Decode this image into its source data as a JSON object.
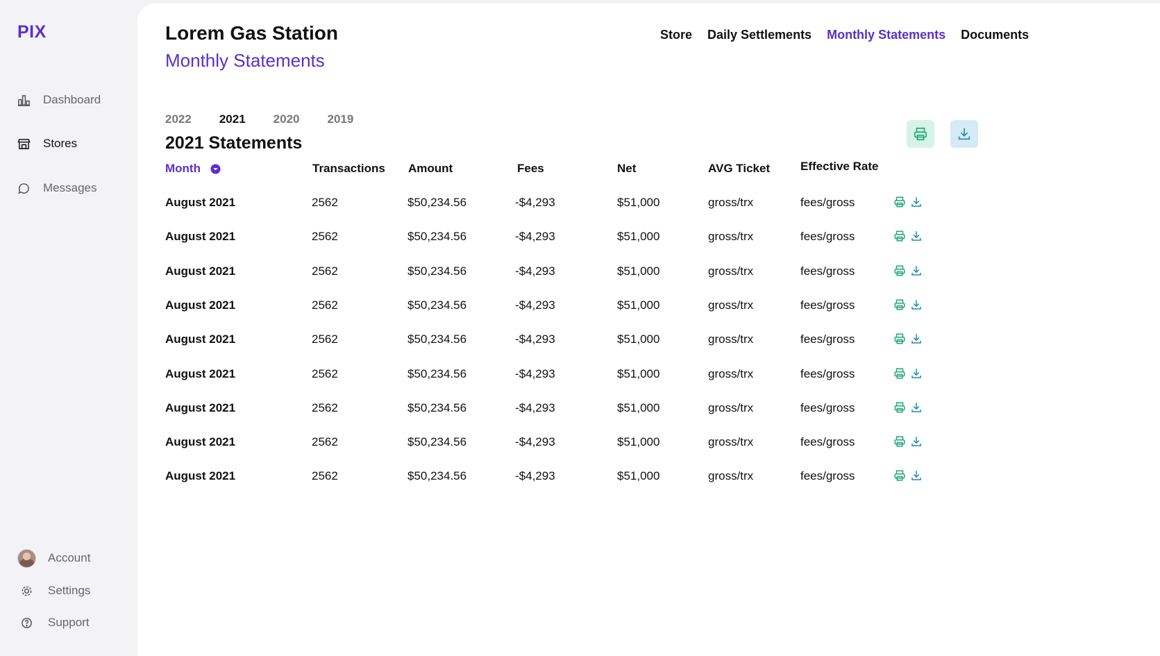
{
  "app": {
    "logo": "PIX"
  },
  "sidebar": {
    "items": [
      {
        "label": "Dashboard",
        "icon": "chart-icon"
      },
      {
        "label": "Stores",
        "icon": "store-icon",
        "active": true
      },
      {
        "label": "Messages",
        "icon": "message-icon"
      }
    ],
    "bottom": [
      {
        "label": "Account",
        "icon": "avatar"
      },
      {
        "label": "Settings",
        "icon": "gear-icon"
      },
      {
        "label": "Support",
        "icon": "help-icon"
      }
    ]
  },
  "header": {
    "store_name": "Lorem Gas Station",
    "subtitle": "Monthly Statements",
    "nav": [
      {
        "label": "Store"
      },
      {
        "label": "Daily Settlements"
      },
      {
        "label": "Monthly Statements",
        "active": true
      },
      {
        "label": "Documents"
      }
    ]
  },
  "years": [
    "2022",
    "2021",
    "2020",
    "2019"
  ],
  "active_year": "2021",
  "section_title": "2021 Statements",
  "colors": {
    "accent": "#5b2fc9",
    "print_green": "#1fa777",
    "download_blue": "#1e88b5",
    "print_bg": "#d6f3e8",
    "download_bg": "#d4ebf5"
  },
  "table": {
    "columns": [
      "Month",
      "Transactions",
      "Amount",
      "Fees",
      "Net",
      "AVG Ticket",
      "Effective Rate"
    ],
    "rows": [
      [
        "August 2021",
        "2562",
        "$50,234.56",
        "-$4,293",
        "$51,000",
        "gross/trx",
        "fees/gross"
      ],
      [
        "August 2021",
        "2562",
        "$50,234.56",
        "-$4,293",
        "$51,000",
        "gross/trx",
        "fees/gross"
      ],
      [
        "August 2021",
        "2562",
        "$50,234.56",
        "-$4,293",
        "$51,000",
        "gross/trx",
        "fees/gross"
      ],
      [
        "August 2021",
        "2562",
        "$50,234.56",
        "-$4,293",
        "$51,000",
        "gross/trx",
        "fees/gross"
      ],
      [
        "August 2021",
        "2562",
        "$50,234.56",
        "-$4,293",
        "$51,000",
        "gross/trx",
        "fees/gross"
      ],
      [
        "August 2021",
        "2562",
        "$50,234.56",
        "-$4,293",
        "$51,000",
        "gross/trx",
        "fees/gross"
      ],
      [
        "August 2021",
        "2562",
        "$50,234.56",
        "-$4,293",
        "$51,000",
        "gross/trx",
        "fees/gross"
      ],
      [
        "August 2021",
        "2562",
        "$50,234.56",
        "-$4,293",
        "$51,000",
        "gross/trx",
        "fees/gross"
      ],
      [
        "August 2021",
        "2562",
        "$50,234.56",
        "-$4,293",
        "$51,000",
        "gross/trx",
        "fees/gross"
      ]
    ]
  }
}
